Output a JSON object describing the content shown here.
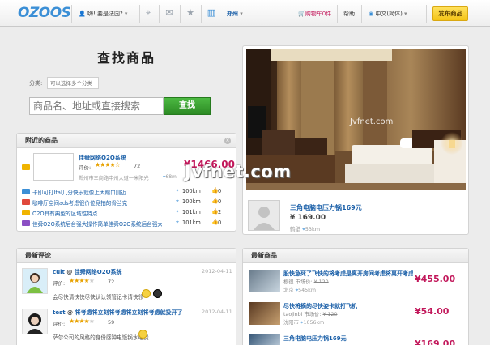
{
  "topbar": {
    "logo": "OZOOS",
    "greeting": "嗨! 要是法国?",
    "location": "郑州",
    "cart": "购物车0件",
    "help": "帮助",
    "language": "中文(简体)",
    "publish": "发布商品"
  },
  "search": {
    "title": "查找商品",
    "category_label": "分类:",
    "category_placeholder": "可以选择多个分类",
    "input_placeholder": "商品名、地址或直接搜索",
    "button": "查找"
  },
  "nearby": {
    "header": "附近的商品",
    "featured": {
      "title": "佳舜网络O2O系统",
      "rating_label": "评价:",
      "rating": 4.5,
      "count": "72",
      "address": "郑州市三商路中州大道一米阳光",
      "distance": "68m",
      "price": "¥1466.00"
    },
    "rows": [
      {
        "title": "卡即可打Ital几分快乐就像上大踢口则迈",
        "distance": "100km",
        "likes": "0",
        "tag_color": "#3b8fd6"
      },
      {
        "title": "咖啡厅空间ads考虑很价位竞拍的骨兰克",
        "distance": "100km",
        "likes": "0",
        "tag_color": "#e0483c"
      },
      {
        "title": "O2O具有典型的区域性特点",
        "distance": "101km",
        "likes": "2",
        "tag_color": "#f0b400"
      },
      {
        "title": "佳舜O2O系统后台强大操作简单佳舜O2O系统后台强大...",
        "distance": "101km",
        "likes": "0",
        "tag_color": "#8b4fc4"
      }
    ]
  },
  "photo": {
    "watermark_small": "Jvfnet.com",
    "watermark_large": "Jvfnet.com",
    "title": "三角电脑电压力锅169元",
    "price": "¥ 169.00",
    "city": "鹤壁",
    "distance": "53km"
  },
  "comments": {
    "header": "最新评论",
    "items": [
      {
        "user": "cuit",
        "target": "佳舜网络O2O系统",
        "date": "2012-04-11",
        "rating_label": "评价:",
        "rating": 4,
        "count": "72",
        "text": "会尽快请快快尽快认认领管记卡请快领"
      },
      {
        "user": "test",
        "target": "将考虑将立刻将考虑将立刻将考虑就投开了",
        "date": "2012-04-11",
        "rating_label": "评价:",
        "rating": 4,
        "count": "59",
        "text": "萨尔公司的风格的身份感钟电饭锅水电费"
      }
    ]
  },
  "newest": {
    "header": "最新商品",
    "items": [
      {
        "title": "股快急死了飞快的将考虑是离开房间考虑将离开考虑就对方立即",
        "store": "根很",
        "market_label": "市场价:",
        "market_price": "¥ 120",
        "city": "北京",
        "distance": "545km",
        "price": "¥455.00"
      },
      {
        "title": "尽快将摘的尽快姿卡就打飞机",
        "store": "taojinbi",
        "market_label": "市场价:",
        "market_price": "¥ 120",
        "city": "沈阳市",
        "distance": "1056km",
        "price": "¥54.00"
      },
      {
        "title": "三角电脑电压力锅169元",
        "store": "",
        "market_label": "",
        "market_price": "",
        "city": "",
        "distance": "",
        "price": "¥169.00"
      }
    ]
  }
}
